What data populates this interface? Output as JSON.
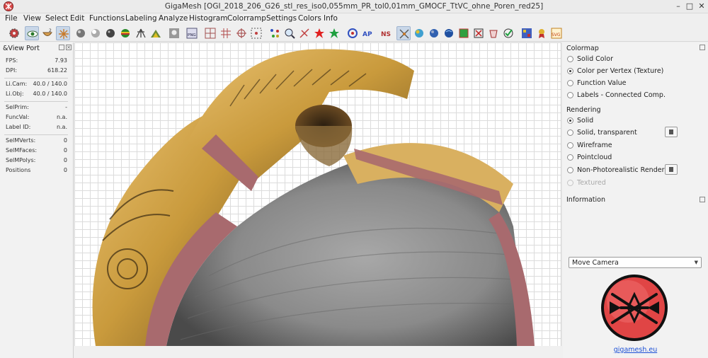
{
  "window": {
    "title": "GigaMesh [OGI_2018_206_G26_stl_res_iso0,055mm_PR_tol0,01mm_GMOCF_TtVC_ohne_Poren_red25]",
    "minimize": "–",
    "maximize": "□",
    "close": "✕"
  },
  "menu": [
    "File",
    "View",
    "Select",
    "Edit",
    "Functions",
    "Labeling",
    "Analyze",
    "Histogram",
    "Colorramp",
    "Settings",
    "Colors",
    "Info"
  ],
  "toolbar_icons": [
    "settings-icon",
    "eye-icon",
    "bowl-icon",
    "light-icon",
    "sphere-grey-icon",
    "sphere-white-icon",
    "sphere-dark-icon",
    "sphere-colored-icon",
    "tripod-icon",
    "mountain-icon",
    "portrait-icon",
    "png-icon",
    "grid-select-icon",
    "grid-icon",
    "crosshair-icon",
    "dotted-grid-icon",
    "scatter-icon",
    "magnifier-icon",
    "vector-icon",
    "red-star-icon",
    "green-star-icon",
    "circle-arrows-icon",
    "ap-icon",
    "ns-icon",
    "axes-icon",
    "colormap-icon",
    "sphere-blue-icon",
    "globe-icon",
    "green-puzzle-icon",
    "cross-box-icon",
    "bucket-icon",
    "checkmark-icon",
    "gallery-icon",
    "award-icon",
    "svg-icon"
  ],
  "viewport_panel": {
    "title": "&View Port",
    "stats": [
      {
        "label": "FPS:",
        "value": "7.93"
      },
      {
        "label": "DPI:",
        "value": "618.22"
      },
      {
        "label": "Li.Cam:",
        "value": "40.0 / 140.0"
      },
      {
        "label": "Li.Obj:",
        "value": "40.0 / 140.0"
      },
      {
        "label": "SelPrim:",
        "value": "-"
      },
      {
        "label": "FuncVal:",
        "value": "n.a."
      },
      {
        "label": "Label ID:",
        "value": "n.a."
      },
      {
        "label": "SelMVerts:",
        "value": "0"
      },
      {
        "label": "SelMFaces:",
        "value": "0"
      },
      {
        "label": "SelMPolys:",
        "value": "0"
      },
      {
        "label": "Positions",
        "value": "0"
      }
    ]
  },
  "colormap": {
    "title": "Colormap",
    "options": [
      "Solid Color",
      "Color per Vertex (Texture)",
      "Function Value",
      "Labels - Connected Comp."
    ],
    "selected_index": 1
  },
  "rendering": {
    "title": "Rendering",
    "options": [
      "Solid",
      "Solid, transparent",
      "Wireframe",
      "Pointcloud",
      "Non-Photorealistic Rendering",
      "Textured"
    ],
    "selected_index": 0
  },
  "information": {
    "title": "Information"
  },
  "mode_select": {
    "value": "Move Camera"
  },
  "link": "gigamesh.eu",
  "colors": {
    "accent": "#e04545",
    "link": "#1a4fd6",
    "mesh_cut": "#a86a6e",
    "ochre": "#c99a3c"
  }
}
